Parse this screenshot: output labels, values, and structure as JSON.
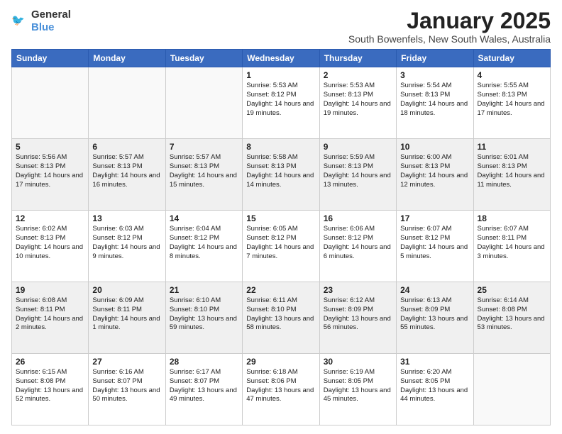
{
  "logo": {
    "general": "General",
    "blue": "Blue"
  },
  "title": "January 2025",
  "location": "South Bowenfels, New South Wales, Australia",
  "weekdays": [
    "Sunday",
    "Monday",
    "Tuesday",
    "Wednesday",
    "Thursday",
    "Friday",
    "Saturday"
  ],
  "weeks": [
    [
      {
        "day": "",
        "info": ""
      },
      {
        "day": "",
        "info": ""
      },
      {
        "day": "",
        "info": ""
      },
      {
        "day": "1",
        "info": "Sunrise: 5:53 AM\nSunset: 8:12 PM\nDaylight: 14 hours and 19 minutes."
      },
      {
        "day": "2",
        "info": "Sunrise: 5:53 AM\nSunset: 8:13 PM\nDaylight: 14 hours and 19 minutes."
      },
      {
        "day": "3",
        "info": "Sunrise: 5:54 AM\nSunset: 8:13 PM\nDaylight: 14 hours and 18 minutes."
      },
      {
        "day": "4",
        "info": "Sunrise: 5:55 AM\nSunset: 8:13 PM\nDaylight: 14 hours and 17 minutes."
      }
    ],
    [
      {
        "day": "5",
        "info": "Sunrise: 5:56 AM\nSunset: 8:13 PM\nDaylight: 14 hours and 17 minutes."
      },
      {
        "day": "6",
        "info": "Sunrise: 5:57 AM\nSunset: 8:13 PM\nDaylight: 14 hours and 16 minutes."
      },
      {
        "day": "7",
        "info": "Sunrise: 5:57 AM\nSunset: 8:13 PM\nDaylight: 14 hours and 15 minutes."
      },
      {
        "day": "8",
        "info": "Sunrise: 5:58 AM\nSunset: 8:13 PM\nDaylight: 14 hours and 14 minutes."
      },
      {
        "day": "9",
        "info": "Sunrise: 5:59 AM\nSunset: 8:13 PM\nDaylight: 14 hours and 13 minutes."
      },
      {
        "day": "10",
        "info": "Sunrise: 6:00 AM\nSunset: 8:13 PM\nDaylight: 14 hours and 12 minutes."
      },
      {
        "day": "11",
        "info": "Sunrise: 6:01 AM\nSunset: 8:13 PM\nDaylight: 14 hours and 11 minutes."
      }
    ],
    [
      {
        "day": "12",
        "info": "Sunrise: 6:02 AM\nSunset: 8:13 PM\nDaylight: 14 hours and 10 minutes."
      },
      {
        "day": "13",
        "info": "Sunrise: 6:03 AM\nSunset: 8:12 PM\nDaylight: 14 hours and 9 minutes."
      },
      {
        "day": "14",
        "info": "Sunrise: 6:04 AM\nSunset: 8:12 PM\nDaylight: 14 hours and 8 minutes."
      },
      {
        "day": "15",
        "info": "Sunrise: 6:05 AM\nSunset: 8:12 PM\nDaylight: 14 hours and 7 minutes."
      },
      {
        "day": "16",
        "info": "Sunrise: 6:06 AM\nSunset: 8:12 PM\nDaylight: 14 hours and 6 minutes."
      },
      {
        "day": "17",
        "info": "Sunrise: 6:07 AM\nSunset: 8:12 PM\nDaylight: 14 hours and 5 minutes."
      },
      {
        "day": "18",
        "info": "Sunrise: 6:07 AM\nSunset: 8:11 PM\nDaylight: 14 hours and 3 minutes."
      }
    ],
    [
      {
        "day": "19",
        "info": "Sunrise: 6:08 AM\nSunset: 8:11 PM\nDaylight: 14 hours and 2 minutes."
      },
      {
        "day": "20",
        "info": "Sunrise: 6:09 AM\nSunset: 8:11 PM\nDaylight: 14 hours and 1 minute."
      },
      {
        "day": "21",
        "info": "Sunrise: 6:10 AM\nSunset: 8:10 PM\nDaylight: 13 hours and 59 minutes."
      },
      {
        "day": "22",
        "info": "Sunrise: 6:11 AM\nSunset: 8:10 PM\nDaylight: 13 hours and 58 minutes."
      },
      {
        "day": "23",
        "info": "Sunrise: 6:12 AM\nSunset: 8:09 PM\nDaylight: 13 hours and 56 minutes."
      },
      {
        "day": "24",
        "info": "Sunrise: 6:13 AM\nSunset: 8:09 PM\nDaylight: 13 hours and 55 minutes."
      },
      {
        "day": "25",
        "info": "Sunrise: 6:14 AM\nSunset: 8:08 PM\nDaylight: 13 hours and 53 minutes."
      }
    ],
    [
      {
        "day": "26",
        "info": "Sunrise: 6:15 AM\nSunset: 8:08 PM\nDaylight: 13 hours and 52 minutes."
      },
      {
        "day": "27",
        "info": "Sunrise: 6:16 AM\nSunset: 8:07 PM\nDaylight: 13 hours and 50 minutes."
      },
      {
        "day": "28",
        "info": "Sunrise: 6:17 AM\nSunset: 8:07 PM\nDaylight: 13 hours and 49 minutes."
      },
      {
        "day": "29",
        "info": "Sunrise: 6:18 AM\nSunset: 8:06 PM\nDaylight: 13 hours and 47 minutes."
      },
      {
        "day": "30",
        "info": "Sunrise: 6:19 AM\nSunset: 8:05 PM\nDaylight: 13 hours and 45 minutes."
      },
      {
        "day": "31",
        "info": "Sunrise: 6:20 AM\nSunset: 8:05 PM\nDaylight: 13 hours and 44 minutes."
      },
      {
        "day": "",
        "info": ""
      }
    ]
  ],
  "row_stripes": [
    false,
    true,
    false,
    true,
    false
  ]
}
